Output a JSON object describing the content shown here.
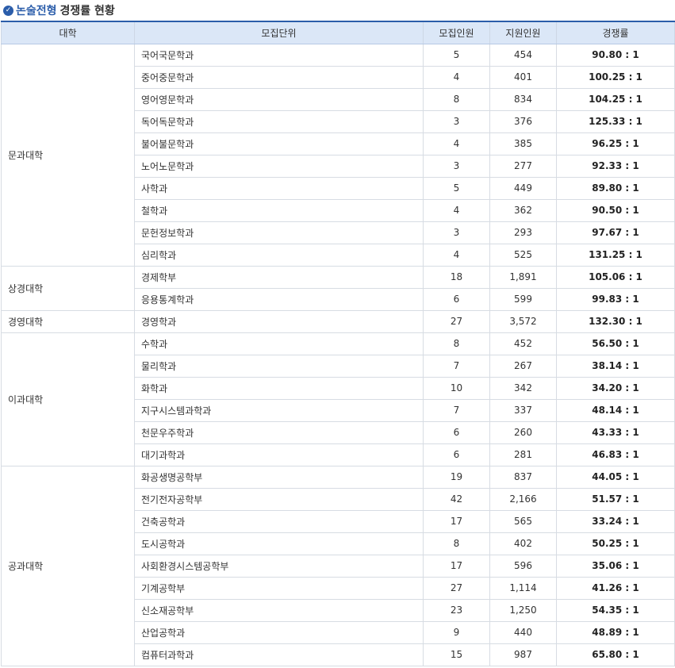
{
  "title": {
    "accent": "논술전형",
    "rest": "경쟁률 현황"
  },
  "colors": {
    "accent": "#2b5daa",
    "header_bg": "#dbe7f7"
  },
  "table": {
    "headers": [
      "대학",
      "모집단위",
      "모집인원",
      "지원인원",
      "경쟁률"
    ],
    "rows": [
      {
        "college": "문과대학",
        "span": 10,
        "unit": "국어국문학과",
        "quota": "5",
        "applicants": "454",
        "ratio": "90.80 : 1"
      },
      {
        "unit": "중어중문학과",
        "quota": "4",
        "applicants": "401",
        "ratio": "100.25 : 1"
      },
      {
        "unit": "영어영문학과",
        "quota": "8",
        "applicants": "834",
        "ratio": "104.25 : 1"
      },
      {
        "unit": "독어독문학과",
        "quota": "3",
        "applicants": "376",
        "ratio": "125.33 : 1"
      },
      {
        "unit": "불어불문학과",
        "quota": "4",
        "applicants": "385",
        "ratio": "96.25 : 1"
      },
      {
        "unit": "노어노문학과",
        "quota": "3",
        "applicants": "277",
        "ratio": "92.33 : 1"
      },
      {
        "unit": "사학과",
        "quota": "5",
        "applicants": "449",
        "ratio": "89.80 : 1"
      },
      {
        "unit": "철학과",
        "quota": "4",
        "applicants": "362",
        "ratio": "90.50 : 1"
      },
      {
        "unit": "문헌정보학과",
        "quota": "3",
        "applicants": "293",
        "ratio": "97.67 : 1"
      },
      {
        "unit": "심리학과",
        "quota": "4",
        "applicants": "525",
        "ratio": "131.25 : 1"
      },
      {
        "college": "상경대학",
        "span": 2,
        "unit": "경제학부",
        "quota": "18",
        "applicants": "1,891",
        "ratio": "105.06 : 1"
      },
      {
        "unit": "응용통계학과",
        "quota": "6",
        "applicants": "599",
        "ratio": "99.83 : 1"
      },
      {
        "college": "경영대학",
        "span": 1,
        "unit": "경영학과",
        "quota": "27",
        "applicants": "3,572",
        "ratio": "132.30 : 1"
      },
      {
        "college": "이과대학",
        "span": 6,
        "unit": "수학과",
        "quota": "8",
        "applicants": "452",
        "ratio": "56.50 : 1"
      },
      {
        "unit": "물리학과",
        "quota": "7",
        "applicants": "267",
        "ratio": "38.14 : 1"
      },
      {
        "unit": "화학과",
        "quota": "10",
        "applicants": "342",
        "ratio": "34.20 : 1"
      },
      {
        "unit": "지구시스템과학과",
        "quota": "7",
        "applicants": "337",
        "ratio": "48.14 : 1"
      },
      {
        "unit": "천문우주학과",
        "quota": "6",
        "applicants": "260",
        "ratio": "43.33 : 1"
      },
      {
        "unit": "대기과학과",
        "quota": "6",
        "applicants": "281",
        "ratio": "46.83 : 1"
      },
      {
        "college": "공과대학",
        "span": 9,
        "unit": "화공생명공학부",
        "quota": "19",
        "applicants": "837",
        "ratio": "44.05 : 1"
      },
      {
        "unit": "전기전자공학부",
        "quota": "42",
        "applicants": "2,166",
        "ratio": "51.57 : 1"
      },
      {
        "unit": "건축공학과",
        "quota": "17",
        "applicants": "565",
        "ratio": "33.24 : 1"
      },
      {
        "unit": "도시공학과",
        "quota": "8",
        "applicants": "402",
        "ratio": "50.25 : 1"
      },
      {
        "unit": "사회환경시스템공학부",
        "quota": "17",
        "applicants": "596",
        "ratio": "35.06 : 1"
      },
      {
        "unit": "기계공학부",
        "quota": "27",
        "applicants": "1,114",
        "ratio": "41.26 : 1"
      },
      {
        "unit": "신소재공학부",
        "quota": "23",
        "applicants": "1,250",
        "ratio": "54.35 : 1"
      },
      {
        "unit": "산업공학과",
        "quota": "9",
        "applicants": "440",
        "ratio": "48.89 : 1"
      },
      {
        "unit": "컴퓨터과학과",
        "quota": "15",
        "applicants": "987",
        "ratio": "65.80 : 1"
      }
    ]
  }
}
